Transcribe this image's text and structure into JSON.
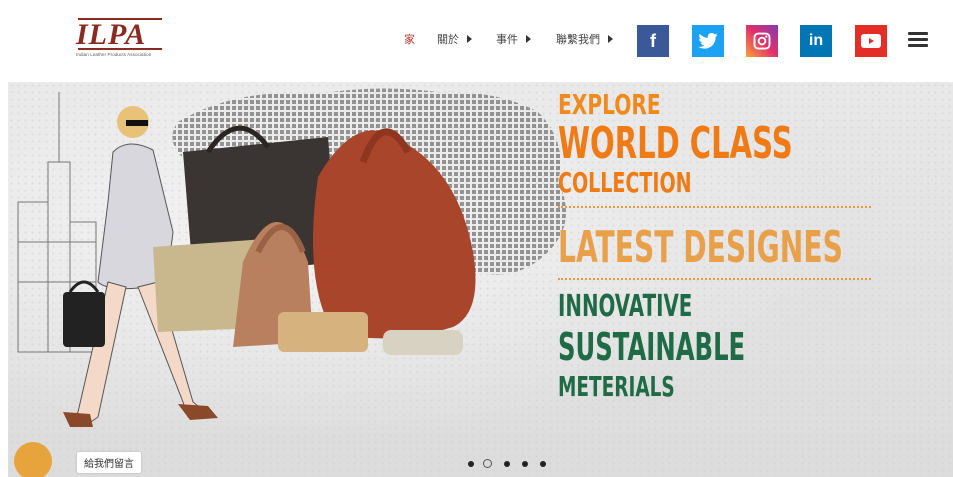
{
  "header": {
    "logo": {
      "mark": "ILPA",
      "subtitle": "Indian Leather Products Association"
    },
    "nav": [
      {
        "label": "家",
        "active": true,
        "has_caret": false
      },
      {
        "label": "關於",
        "active": false,
        "has_caret": true
      },
      {
        "label": "事件",
        "active": false,
        "has_caret": true
      },
      {
        "label": "聯繫我們",
        "active": false,
        "has_caret": true
      }
    ],
    "social": [
      {
        "icon": "facebook-icon",
        "glyph": "f",
        "color": "#3b5998"
      },
      {
        "icon": "twitter-icon",
        "glyph": "",
        "color": "#1da1f2"
      },
      {
        "icon": "instagram-icon",
        "glyph": "",
        "color": "#e1306c"
      },
      {
        "icon": "linkedin-icon",
        "glyph": "in",
        "color": "#0077b5"
      },
      {
        "icon": "youtube-icon",
        "glyph": "",
        "color": "#e52d27"
      }
    ],
    "menu_icon": "hamburger-menu-icon"
  },
  "hero": {
    "line1": "EXPLORE",
    "line2": "WORLD CLASS",
    "line3": "COLLECTION",
    "line4": "LATEST DESIGNES",
    "line5": "INNOVATIVE",
    "line6": "SUSTAINABLE",
    "line7": "METERIALS",
    "colors": {
      "orange": "#f07a14",
      "tan": "#e8a04a",
      "green": "#1f6b45"
    }
  },
  "slider": {
    "total": 5,
    "active_index": 1
  },
  "chat": {
    "label": "給我們留言",
    "bubble_color": "#e8a43c"
  }
}
